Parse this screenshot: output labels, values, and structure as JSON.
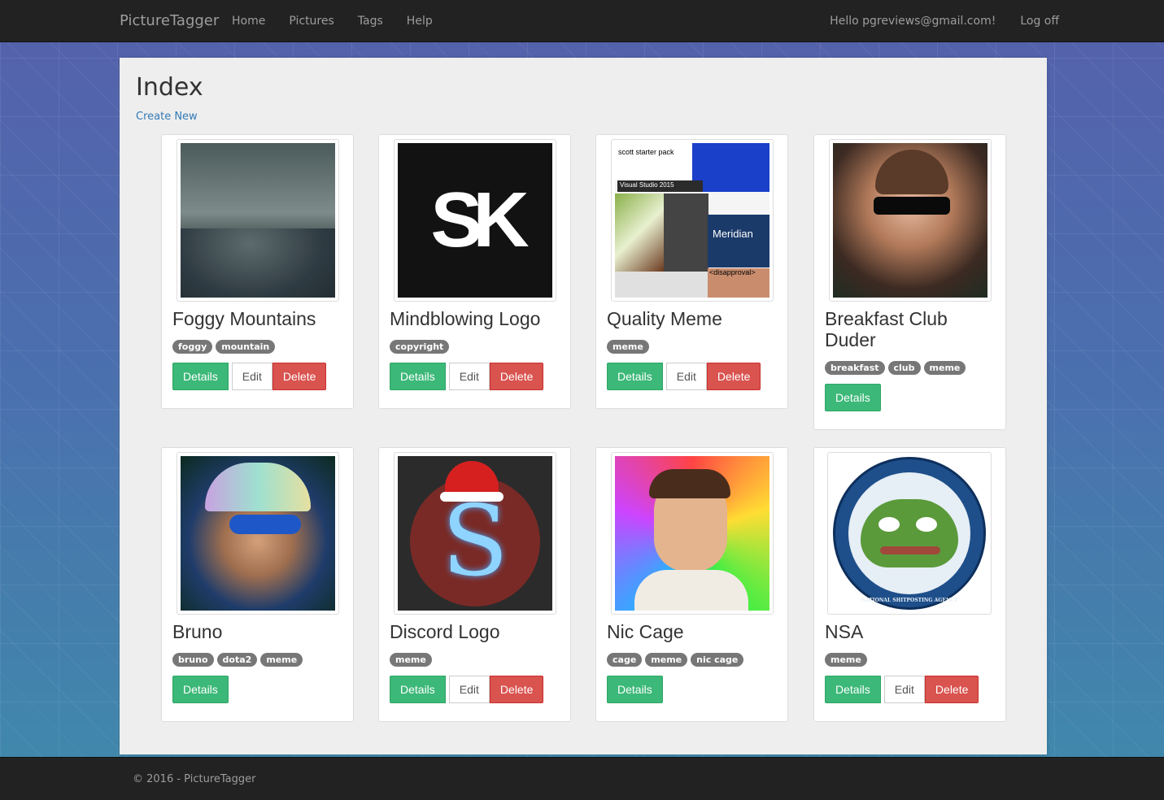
{
  "nav": {
    "brand": "PictureTagger",
    "links": [
      "Home",
      "Pictures",
      "Tags",
      "Help"
    ],
    "greeting": "Hello pgreviews@gmail.com!",
    "logoff": "Log off"
  },
  "page": {
    "title": "Index",
    "create_new": "Create New"
  },
  "buttons": {
    "details": "Details",
    "edit": "Edit",
    "delete": "Delete"
  },
  "cards": [
    {
      "title": "Foggy Mountains",
      "tags": [
        "foggy",
        "mountain"
      ],
      "image_icon": "landscape-image"
    },
    {
      "title": "Mindblowing Logo",
      "tags": [
        "copyright"
      ],
      "image_icon": "logo-image"
    },
    {
      "title": "Quality Meme",
      "tags": [
        "meme"
      ],
      "image_icon": "meme-collage-image"
    },
    {
      "title": "Breakfast Club Duder",
      "tags": [
        "breakfast",
        "club",
        "meme"
      ],
      "image_icon": "portrait-image"
    },
    {
      "title": "Bruno",
      "tags": [
        "bruno",
        "dota2",
        "meme"
      ],
      "image_icon": "portrait-image"
    },
    {
      "title": "Discord Logo",
      "tags": [
        "meme"
      ],
      "image_icon": "logo-image"
    },
    {
      "title": "Nic Cage",
      "tags": [
        "cage",
        "meme",
        "nic cage"
      ],
      "image_icon": "portrait-image"
    },
    {
      "title": "NSA",
      "tags": [
        "meme"
      ],
      "image_icon": "seal-image"
    }
  ],
  "meme_text": {
    "line1": "scott starter pack",
    "line2": "Visual Studio 2015",
    "line3": "Meridian",
    "line4": "<disapproval>"
  },
  "seal_text": "NATIONAL SHITPOSTING AGENCY",
  "footer": "© 2016 - PictureTagger",
  "colors": {
    "navbar": "#222222",
    "success": "#3cb878",
    "danger": "#d9534f",
    "tag": "#777777",
    "link": "#337ab7"
  }
}
